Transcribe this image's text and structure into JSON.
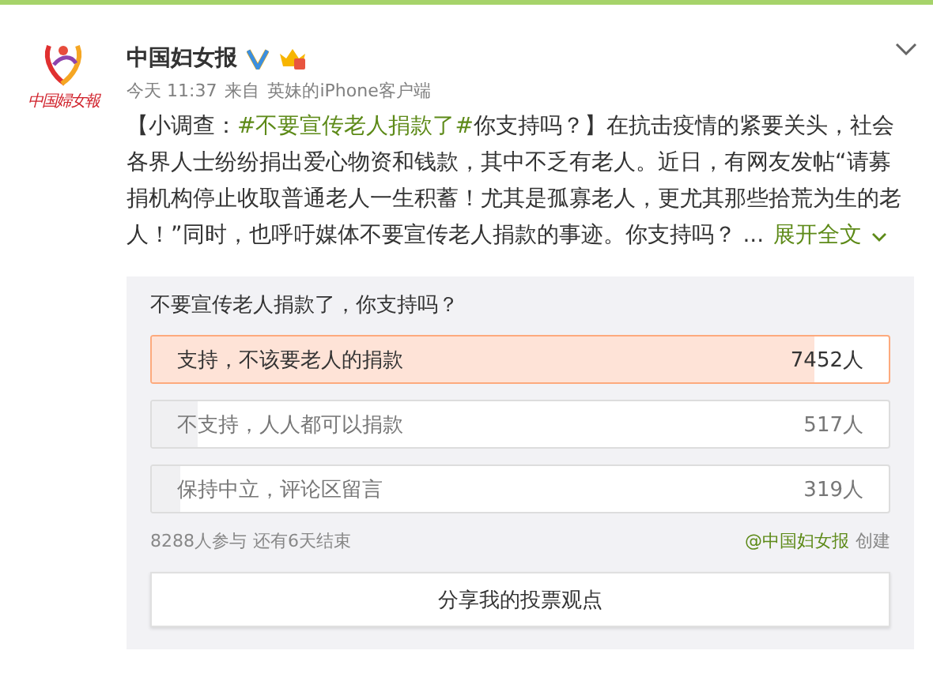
{
  "post": {
    "avatar": {
      "logo_text": "中国婦女報"
    },
    "author": "中国妇女报",
    "verified": true,
    "member": true,
    "time": "今天 11:37",
    "source_prefix": "来自",
    "source": "英妹的iPhone客户端",
    "body": [
      {
        "kind": "text",
        "text": "【小调查："
      },
      {
        "kind": "topic",
        "text": "#不要宣传老人捐款了#"
      },
      {
        "kind": "text",
        "text": "你支持吗？】在抗击疫情的紧要关头，社会各界人士纷纷捐出爱心物资和钱款，其中不乏有老人。近日，有网友发帖“请募捐机构停止收取普通老人一生积蓄！尤其是孤寡老人，更尤其那些拾荒为生的老人！”同时，也呼吁媒体不要宣传老人捐款的事迹。你支持吗？ ..."
      }
    ],
    "expand": "展开全文"
  },
  "poll": {
    "question": "不要宣传老人捐款了，你支持吗？",
    "options": [
      {
        "label": "支持，不该要老人的捐款",
        "count": "7452人",
        "level": 0.9,
        "selected": true
      },
      {
        "label": "不支持，人人都可以捐款",
        "count": "517人",
        "level": 0.062,
        "selected": false
      },
      {
        "label": "保持中立，评论区留言",
        "count": "319人",
        "level": 0.038,
        "selected": false
      }
    ],
    "participants": "8288人参与",
    "remaining": "还有6天结束",
    "creator": "@中国妇女报",
    "created": "创建",
    "share": "分享我的投票观点"
  }
}
